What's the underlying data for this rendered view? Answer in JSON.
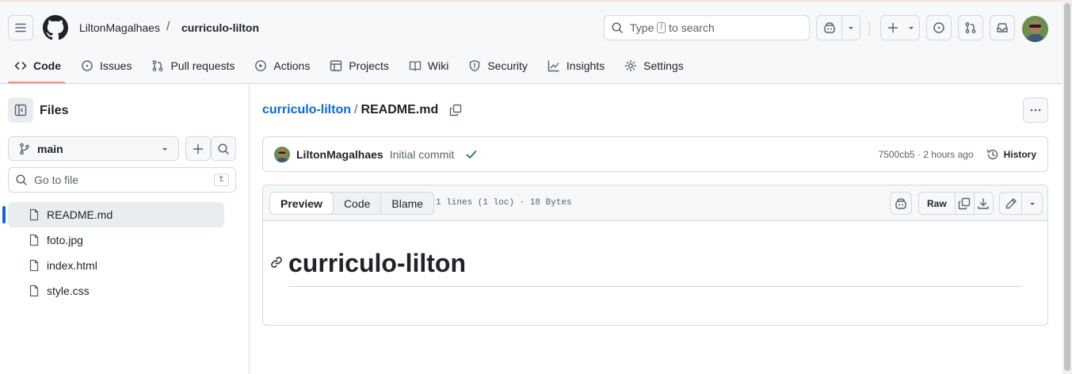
{
  "header": {
    "owner": "LiltonMagalhaes",
    "separator": "/",
    "repo": "curriculo-lilton",
    "search": {
      "before": "Type",
      "key": "/",
      "after": "to search"
    }
  },
  "tabs": [
    {
      "label": "Code",
      "icon": "code-icon"
    },
    {
      "label": "Issues",
      "icon": "issue-opened-icon"
    },
    {
      "label": "Pull requests",
      "icon": "git-pull-request-icon"
    },
    {
      "label": "Actions",
      "icon": "play-icon"
    },
    {
      "label": "Projects",
      "icon": "table-icon"
    },
    {
      "label": "Wiki",
      "icon": "book-icon"
    },
    {
      "label": "Security",
      "icon": "shield-icon"
    },
    {
      "label": "Insights",
      "icon": "graph-icon"
    },
    {
      "label": "Settings",
      "icon": "gear-icon"
    }
  ],
  "sidebar": {
    "title": "Files",
    "branch": "main",
    "goto_placeholder": "Go to file",
    "goto_key": "t",
    "files": [
      {
        "name": "README.md",
        "selected": true
      },
      {
        "name": "foto.jpg",
        "selected": false
      },
      {
        "name": "index.html",
        "selected": false
      },
      {
        "name": "style.css",
        "selected": false
      }
    ]
  },
  "breadcrumb": {
    "repo": "curriculo-lilton",
    "separator": "/",
    "file": "README.md"
  },
  "commit": {
    "author": "LiltonMagalhaes",
    "message": "Initial commit",
    "hash_time": "7500cb5 · 2 hours ago",
    "history_label": "History"
  },
  "file_view": {
    "tabs": [
      "Preview",
      "Code",
      "Blame"
    ],
    "active_tab": "Preview",
    "info": "1 lines (1 loc) · 18 Bytes",
    "raw_label": "Raw"
  },
  "readme": {
    "heading": "curriculo-lilton"
  },
  "colors": {
    "accent_link": "#0969da",
    "tab_underline": "#fd8c73",
    "success": "#1a7f37"
  }
}
